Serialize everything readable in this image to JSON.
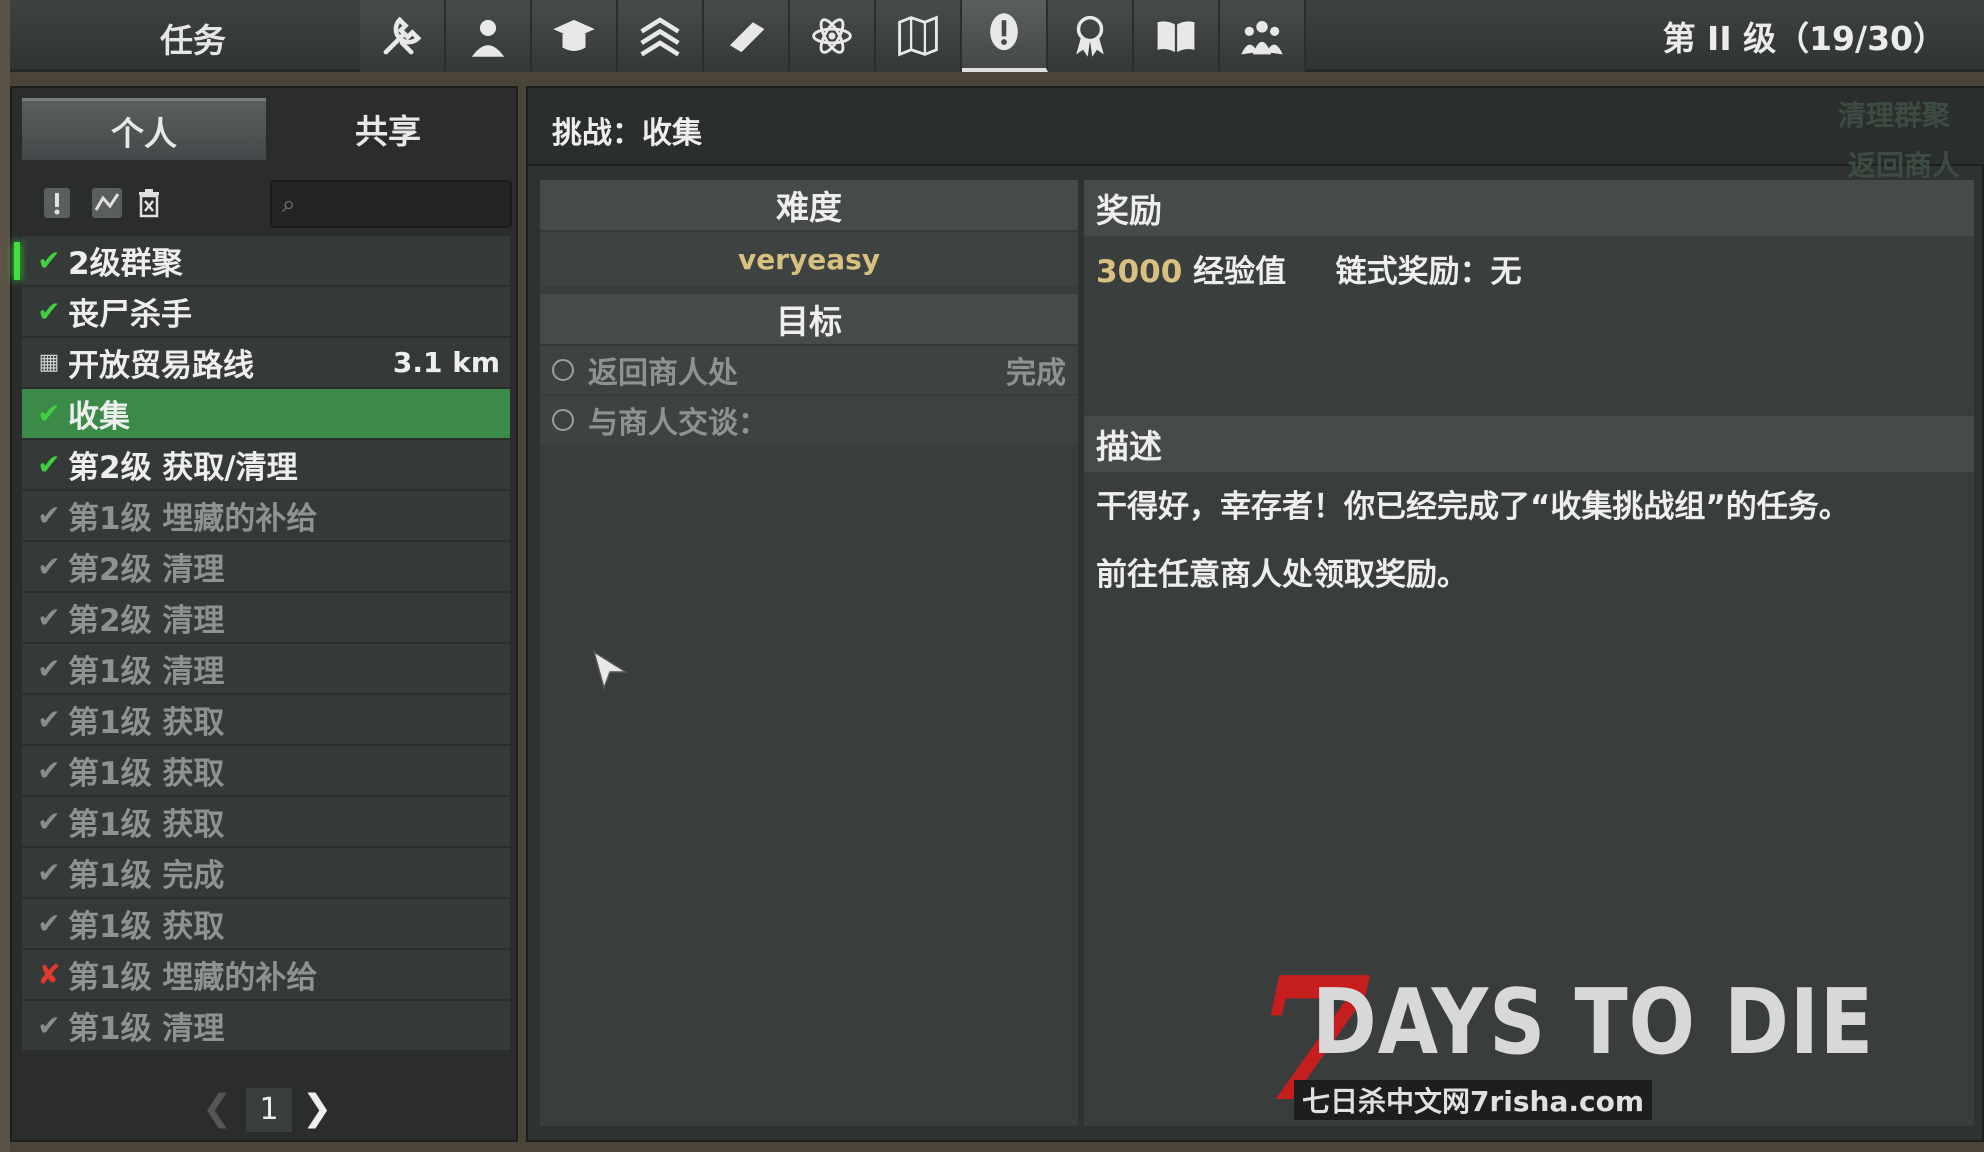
{
  "topbar": {
    "title": "任务",
    "level": "第 II 级（19/30）",
    "icons": [
      "wrench-icon",
      "character-icon",
      "graduation-cap-icon",
      "rank-chevron-icon",
      "book-icon",
      "atom-icon",
      "map-icon",
      "quest-exclamation-icon",
      "award-ribbon-icon",
      "open-book-icon",
      "players-icon"
    ]
  },
  "left": {
    "tabs": [
      {
        "label": "个人"
      },
      {
        "label": "共享"
      }
    ],
    "search": {
      "placeholder": ""
    },
    "quests": [
      {
        "name": "2级群聚",
        "mark": "✔",
        "state": "done"
      },
      {
        "name": "丧尸杀手",
        "mark": "✔",
        "state": "done"
      },
      {
        "name": "开放贸易路线",
        "mark": "▦",
        "state": "trade",
        "dist": "3.1 km"
      },
      {
        "name": "收集",
        "mark": "✔",
        "state": "done"
      },
      {
        "name": "第2级 获取/清理",
        "mark": "✔",
        "state": "done"
      },
      {
        "name": "第1级 埋藏的补给",
        "mark": "✔",
        "state": "grey"
      },
      {
        "name": "第2级 清理",
        "mark": "✔",
        "state": "grey"
      },
      {
        "name": "第2级 清理",
        "mark": "✔",
        "state": "grey"
      },
      {
        "name": "第1级 清理",
        "mark": "✔",
        "state": "grey"
      },
      {
        "name": "第1级 获取",
        "mark": "✔",
        "state": "grey"
      },
      {
        "name": "第1级 获取",
        "mark": "✔",
        "state": "grey"
      },
      {
        "name": "第1级 获取",
        "mark": "✔",
        "state": "grey"
      },
      {
        "name": "第1级 完成",
        "mark": "✔",
        "state": "grey"
      },
      {
        "name": "第1级 获取",
        "mark": "✔",
        "state": "grey"
      },
      {
        "name": "第1级 埋藏的补给",
        "mark": "✘",
        "state": "fail"
      },
      {
        "name": "第1级 清理",
        "mark": "✔",
        "state": "grey"
      }
    ],
    "page": "1"
  },
  "detail": {
    "title": "挑战：收集",
    "ghost_1": "清理群聚",
    "ghost_2": "返回商人处",
    "difficulty_label": "难度",
    "difficulty_value": "veryeasy",
    "objective_label": "目标",
    "objectives": [
      {
        "label": "返回商人处",
        "status": "完成"
      },
      {
        "label": "与商人交谈：",
        "status": ""
      }
    ],
    "reward_label": "奖励",
    "reward_xp": "3000",
    "reward_xp_unit": "经验值",
    "reward_chain": "链式奖励：无",
    "description_label": "描述",
    "description_lines": [
      "干得好，幸存者！你已经完成了“收集挑战组”的任务。",
      "前往任意商人处领取奖励。"
    ]
  },
  "logo": {
    "seven": "7",
    "main": "DAYS TO DIE",
    "sub": "七日杀中文网7risha.com"
  },
  "colors": {
    "selected_row": "#3b8a48",
    "done_check": "#3fd040",
    "fail_mark": "#e23a2a",
    "xp_value": "#d8c080"
  }
}
